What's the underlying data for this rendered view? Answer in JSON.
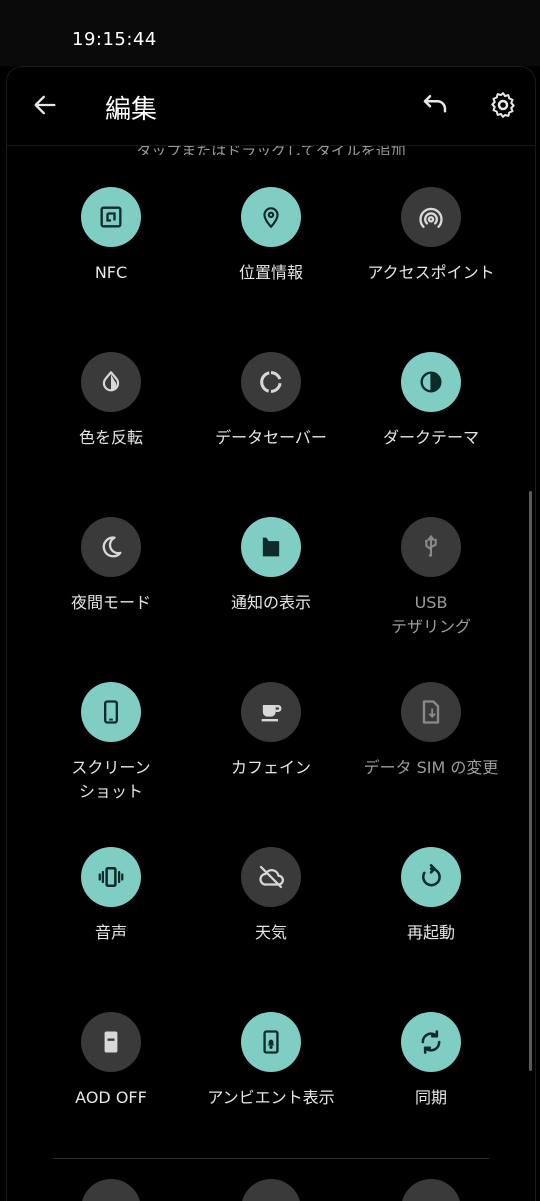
{
  "status_bar": {
    "time": "19:15:44"
  },
  "toolbar": {
    "title": "編集",
    "back_icon": "arrow-left-icon",
    "undo_icon": "undo-icon",
    "settings_icon": "gear-icon"
  },
  "hint_text": "タップまたはドラッグしてタイルを追加",
  "colors": {
    "tile_on": "#7fcdc3",
    "tile_off": "#3a3a3a"
  },
  "tiles": [
    {
      "label": "NFC",
      "icon": "nfc-icon",
      "active": true
    },
    {
      "label": "位置情報",
      "icon": "location-pin-icon",
      "active": true
    },
    {
      "label": "アクセスポイント",
      "icon": "hotspot-icon",
      "active": false
    },
    {
      "label": "色を反転",
      "icon": "invert-colors-icon",
      "active": false
    },
    {
      "label": "データセーバー",
      "icon": "data-saver-icon",
      "active": false
    },
    {
      "label": "ダークテーマ",
      "icon": "dark-theme-icon",
      "active": true
    },
    {
      "label": "夜間モード",
      "icon": "moon-icon",
      "active": false
    },
    {
      "label": "通知の表示",
      "icon": "notification-icon",
      "active": true
    },
    {
      "label": "USB\nテザリング",
      "icon": "usb-icon",
      "active": false,
      "disabled": true
    },
    {
      "label": "スクリーン\nショット",
      "icon": "phone-screenshot-icon",
      "active": true
    },
    {
      "label": "カフェイン",
      "icon": "coffee-cup-icon",
      "active": false
    },
    {
      "label": "データ SIM の変更",
      "icon": "sim-card-icon",
      "active": false,
      "disabled": true
    },
    {
      "label": "音声",
      "icon": "vibrate-icon",
      "active": true
    },
    {
      "label": "天気",
      "icon": "cloud-off-icon",
      "active": false
    },
    {
      "label": "再起動",
      "icon": "restart-icon",
      "active": true
    },
    {
      "label": "AOD OFF",
      "icon": "aod-icon",
      "active": false
    },
    {
      "label": "アンビエント表示",
      "icon": "ambient-display-icon",
      "active": true
    },
    {
      "label": "同期",
      "icon": "sync-icon",
      "active": true
    }
  ]
}
